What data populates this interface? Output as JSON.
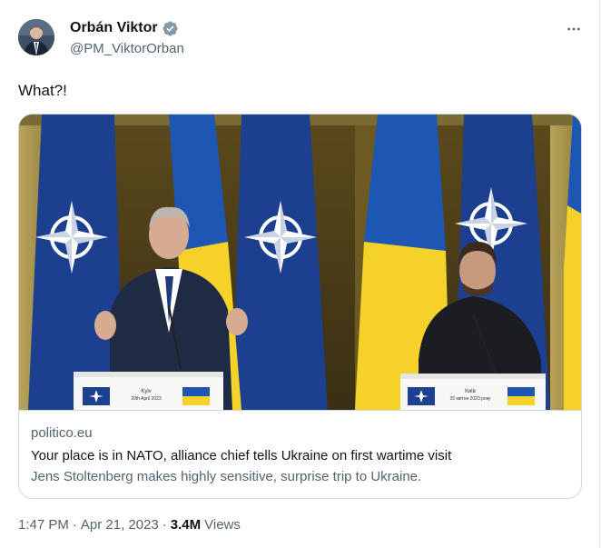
{
  "author": {
    "name": "Orbán Viktor",
    "handle": "@PM_ViktorOrban"
  },
  "tweet": {
    "text": "What?!"
  },
  "card": {
    "image": {
      "left_podium_city": "Kyiv",
      "left_podium_date": "20th April 2023",
      "right_podium_city": "Київ",
      "right_podium_date": "20 квітня 2023 року"
    },
    "domain": "politico.eu",
    "title": "Your place is in NATO, alliance chief tells Ukraine on first wartime visit",
    "description": "Jens Stoltenberg makes highly sensitive, surprise trip to Ukraine."
  },
  "footer": {
    "time": "1:47 PM",
    "separator": "·",
    "date": "Apr 21, 2023",
    "views_count": "3.4M",
    "views_label": "Views"
  },
  "colors": {
    "verified_badge": "#829aab",
    "secondary_text": "#536471",
    "primary_text": "#0f1419",
    "border": "#cfd9de",
    "nato_blue": "#1c3f8f",
    "ukraine_blue": "#1e56b3",
    "ukraine_yellow": "#f5d22a"
  },
  "icons": {
    "verified": "verified-badge-icon",
    "more": "more-options-icon"
  }
}
